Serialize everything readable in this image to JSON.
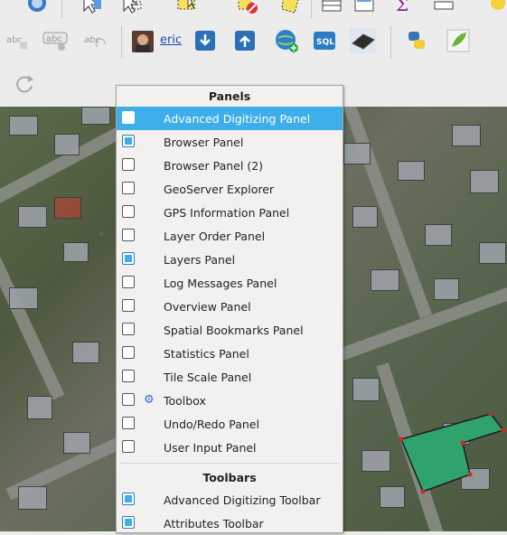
{
  "toolbar": {
    "user_name": "eric"
  },
  "menu": {
    "panels_header": "Panels",
    "toolbars_header": "Toolbars",
    "panels": [
      {
        "label": "Advanced Digitizing Panel",
        "checked": false,
        "active": true
      },
      {
        "label": "Browser Panel",
        "checked": true,
        "active": false
      },
      {
        "label": "Browser Panel (2)",
        "checked": false,
        "active": false
      },
      {
        "label": "GeoServer Explorer",
        "checked": false,
        "active": false
      },
      {
        "label": "GPS Information Panel",
        "checked": false,
        "active": false
      },
      {
        "label": "Layer Order Panel",
        "checked": false,
        "active": false
      },
      {
        "label": "Layers Panel",
        "checked": true,
        "active": false
      },
      {
        "label": "Log Messages Panel",
        "checked": false,
        "active": false
      },
      {
        "label": "Overview Panel",
        "checked": false,
        "active": false
      },
      {
        "label": "Spatial Bookmarks Panel",
        "checked": false,
        "active": false
      },
      {
        "label": "Statistics Panel",
        "checked": false,
        "active": false
      },
      {
        "label": "Tile Scale Panel",
        "checked": false,
        "active": false
      },
      {
        "label": "Toolbox",
        "checked": false,
        "active": false,
        "icon": "gear-icon"
      },
      {
        "label": "Undo/Redo Panel",
        "checked": false,
        "active": false
      },
      {
        "label": "User Input Panel",
        "checked": false,
        "active": false
      }
    ],
    "toolbars": [
      {
        "label": "Advanced Digitizing Toolbar",
        "checked": true
      },
      {
        "label": "Attributes Toolbar",
        "checked": true
      }
    ]
  },
  "colors": {
    "accent": "#3daee9",
    "polygon_fill": "#2fa36b"
  }
}
